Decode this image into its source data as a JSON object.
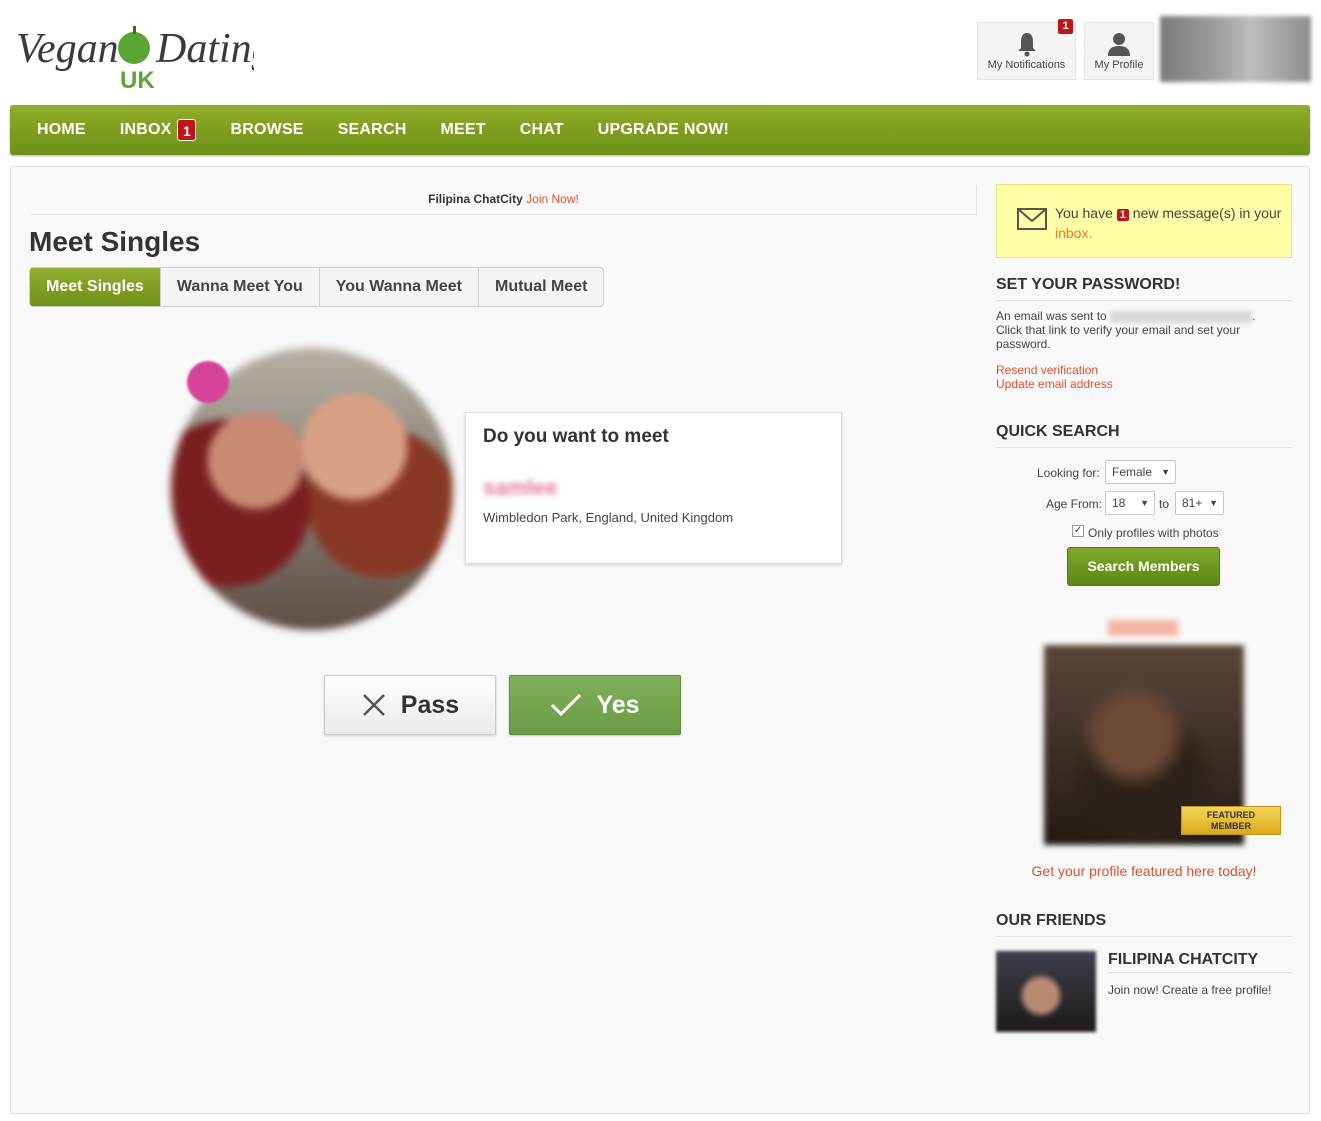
{
  "logo": {
    "text_top": "Vegan Dating",
    "text_sub": "UK"
  },
  "header": {
    "notifications": {
      "label": "My Notifications",
      "badge": "1"
    },
    "profile": {
      "label": "My Profile"
    }
  },
  "nav": {
    "items": [
      {
        "label": "HOME"
      },
      {
        "label": "INBOX",
        "badge": "1"
      },
      {
        "label": "BROWSE"
      },
      {
        "label": "SEARCH"
      },
      {
        "label": "MEET"
      },
      {
        "label": "CHAT"
      },
      {
        "label": "UPGRADE NOW!"
      }
    ]
  },
  "promo": {
    "site": "Filipina ChatCity",
    "link": "Join Now!"
  },
  "page_title": "Meet Singles",
  "tabs": [
    {
      "label": "Meet Singles",
      "active": true
    },
    {
      "label": "Wanna Meet You"
    },
    {
      "label": "You Wanna Meet"
    },
    {
      "label": "Mutual Meet"
    }
  ],
  "meet_card": {
    "question": "Do you want to meet",
    "name": "samlee",
    "location": "Wimbledon Park, England, United Kingdom"
  },
  "actions": {
    "pass": "Pass",
    "yes": "Yes"
  },
  "message_box": {
    "prefix": "You have",
    "count": "1",
    "middle": "new message(s) in your",
    "link": "inbox."
  },
  "password": {
    "heading": "SET YOUR PASSWORD!",
    "text1": "An email was sent to",
    "text2": "Click that link to verify your email and set your password.",
    "resend": "Resend verification",
    "update": "Update email address"
  },
  "quick_search": {
    "heading": "QUICK SEARCH",
    "looking_for_label": "Looking for:",
    "looking_for_value": "Female",
    "age_from_label": "Age From:",
    "age_from_value": "18",
    "age_to_label": "to",
    "age_to_value": "81+",
    "photos_only_label": "Only profiles with photos",
    "photos_only_checked": true,
    "button": "Search Members"
  },
  "featured": {
    "badge_line1": "FEATURED",
    "badge_line2": "MEMBER",
    "link": "Get your profile featured here today!"
  },
  "friends": {
    "heading": "OUR FRIENDS",
    "title": "FILIPINA CHATCITY",
    "desc": "Join now! Create a free profile!"
  },
  "colors": {
    "brand_green": "#7a9a1f",
    "badge_red": "#c0141b",
    "link_orange": "#d9532b"
  }
}
